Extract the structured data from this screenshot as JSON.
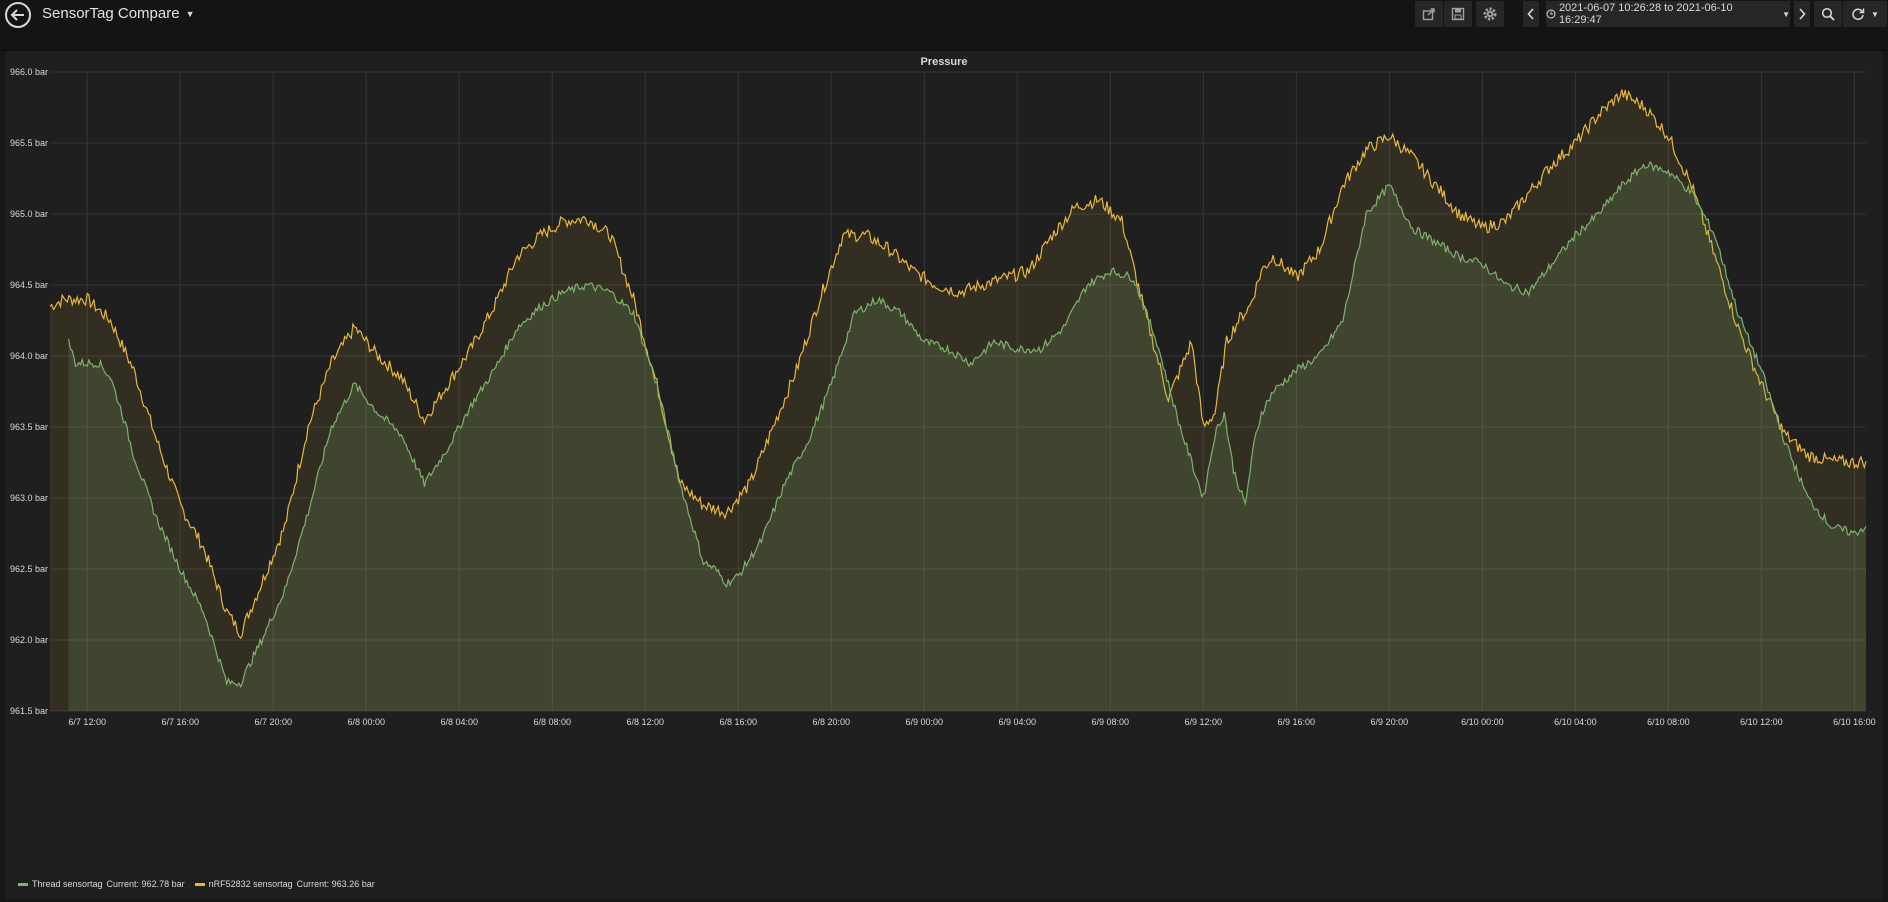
{
  "app": {
    "dashboard_title": "SensorTag Compare",
    "time_range": "2021-06-07 10:26:28 to 2021-06-10 16:29:47"
  },
  "toolbar": {
    "icons": [
      "share-icon",
      "save-icon",
      "settings-icon",
      "chevron-left-icon",
      "clock-icon",
      "chevron-right-icon",
      "zoom-out-icon",
      "refresh-icon"
    ]
  },
  "colors": {
    "green": "#7eb26d",
    "yellow": "#eab839",
    "panel_bg": "#1f1f20",
    "grid": "#353637"
  },
  "panel": {
    "title": "Pressure"
  },
  "chart_data": {
    "type": "area",
    "title": "Pressure",
    "xlabel": "",
    "ylabel": "",
    "x_ticks": [
      "6/7 12:00",
      "6/7 16:00",
      "6/7 20:00",
      "6/8 00:00",
      "6/8 04:00",
      "6/8 08:00",
      "6/8 12:00",
      "6/8 16:00",
      "6/8 20:00",
      "6/9 00:00",
      "6/9 04:00",
      "6/9 08:00",
      "6/9 12:00",
      "6/9 16:00",
      "6/9 20:00",
      "6/10 00:00",
      "6/10 04:00",
      "6/10 08:00",
      "6/10 12:00",
      "6/10 16:00"
    ],
    "y_ticks": [
      "966.0 bar",
      "965.5 bar",
      "965.0 bar",
      "964.5 bar",
      "964.0 bar",
      "963.5 bar",
      "963.0 bar",
      "962.5 bar",
      "962.0 bar",
      "961.5 bar"
    ],
    "ylim": [
      961.5,
      966.0
    ],
    "xlim_hours": [
      -1.6,
      76.5
    ],
    "grid": true,
    "legend_position": "bottom-left",
    "series": [
      {
        "name": "Thread sensortag",
        "current": "Current: 962.78 bar",
        "color": "#7eb26d",
        "x_hours": [
          -0.8,
          -0.5,
          0,
          0.5,
          1.0,
          1.5,
          2.0,
          3.0,
          4.0,
          5.0,
          6.0,
          6.6,
          7.5,
          8.5,
          9.5,
          10.5,
          11.5,
          12.5,
          13.5,
          14.5,
          15.5,
          16.5,
          17.5,
          18.5,
          19.5,
          20.5,
          21.5,
          22.5,
          23.5,
          24.5,
          25.5,
          26.5,
          27.0,
          27.5,
          28.0,
          29.0,
          30.0,
          31.0,
          32.0,
          33.0,
          34.0,
          35.0,
          36.0,
          37.0,
          38.0,
          39.0,
          40.0,
          41.0,
          42.0,
          43.0,
          44.0,
          45.0,
          46.0,
          47.0,
          48.0,
          48.5,
          48.9,
          49.3,
          49.8,
          50.2,
          50.5,
          51.0,
          52.0,
          53.0,
          54.0,
          55.0,
          56.0,
          56.5,
          57.0,
          58.0,
          59.0,
          60.0,
          61.0,
          62.0,
          63.0,
          64.0,
          65.0,
          66.0,
          67.0,
          68.0,
          69.0,
          70.0,
          71.0,
          72.0,
          73.0,
          74.0,
          75.0,
          76.0,
          76.5
        ],
        "values": [
          964.1,
          963.95,
          963.95,
          963.95,
          963.85,
          963.6,
          963.3,
          962.85,
          962.5,
          962.2,
          961.7,
          961.7,
          962.0,
          962.35,
          962.9,
          963.5,
          963.8,
          963.6,
          963.45,
          963.1,
          963.35,
          963.65,
          963.9,
          964.2,
          964.35,
          964.45,
          964.5,
          964.45,
          964.3,
          963.8,
          963.1,
          962.55,
          962.5,
          962.4,
          962.45,
          962.7,
          963.1,
          963.4,
          963.8,
          964.3,
          964.4,
          964.3,
          964.1,
          964.05,
          963.95,
          964.1,
          964.05,
          964.05,
          964.2,
          964.5,
          964.6,
          964.55,
          964.1,
          963.5,
          963.0,
          963.45,
          963.6,
          963.2,
          962.95,
          963.4,
          963.6,
          963.75,
          963.9,
          964.0,
          964.25,
          965.0,
          965.2,
          965.05,
          964.9,
          964.8,
          964.7,
          964.65,
          964.5,
          964.45,
          964.65,
          964.85,
          965.0,
          965.2,
          965.35,
          965.3,
          965.15,
          964.85,
          964.3,
          963.9,
          963.4,
          963.0,
          962.8,
          962.75,
          962.8
        ]
      },
      {
        "name": "nRF52832 sensortag",
        "current": "Current: 963.26 bar",
        "color": "#eab839",
        "x_hours": [
          -1.6,
          -1.0,
          0,
          1.0,
          2.0,
          3.0,
          4.0,
          5.0,
          6.0,
          6.6,
          7.5,
          8.5,
          9.5,
          10.5,
          11.5,
          12.5,
          13.5,
          14.5,
          15.5,
          16.5,
          17.5,
          18.5,
          19.5,
          20.5,
          21.5,
          22.5,
          23.5,
          24.5,
          25.5,
          26.5,
          27.5,
          28.5,
          29.5,
          30.5,
          31.5,
          32.5,
          33.5,
          34.5,
          35.5,
          36.5,
          37.5,
          38.5,
          39.5,
          40.5,
          41.5,
          42.5,
          43.5,
          44.5,
          45.5,
          46.5,
          47.5,
          48.0,
          48.5,
          49.0,
          49.5,
          50.0,
          50.5,
          51.0,
          52.0,
          53.0,
          54.0,
          55.0,
          56.0,
          57.0,
          58.0,
          59.0,
          60.0,
          61.0,
          62.0,
          63.0,
          64.0,
          65.0,
          66.0,
          67.0,
          68.0,
          69.0,
          70.0,
          71.0,
          72.0,
          73.0,
          74.0,
          75.0,
          76.0,
          76.5
        ],
        "values": [
          964.35,
          964.4,
          964.4,
          964.25,
          963.9,
          963.4,
          962.95,
          962.65,
          962.2,
          962.05,
          962.4,
          962.8,
          963.5,
          963.95,
          964.2,
          964.0,
          963.85,
          963.55,
          963.8,
          964.05,
          964.35,
          964.7,
          964.85,
          964.95,
          964.97,
          964.85,
          964.4,
          963.8,
          963.1,
          962.95,
          962.9,
          963.1,
          963.5,
          963.9,
          964.4,
          964.85,
          964.85,
          964.75,
          964.6,
          964.5,
          964.45,
          964.5,
          964.55,
          964.6,
          964.85,
          965.05,
          965.1,
          964.95,
          964.3,
          963.7,
          964.1,
          963.5,
          963.6,
          964.1,
          964.25,
          964.35,
          964.6,
          964.7,
          964.55,
          964.75,
          965.2,
          965.45,
          965.55,
          965.4,
          965.2,
          965.0,
          964.9,
          964.95,
          965.15,
          965.35,
          965.5,
          965.7,
          965.85,
          965.75,
          965.55,
          965.2,
          964.7,
          964.2,
          963.8,
          963.45,
          963.3,
          963.26,
          963.25,
          963.26
        ]
      }
    ]
  }
}
